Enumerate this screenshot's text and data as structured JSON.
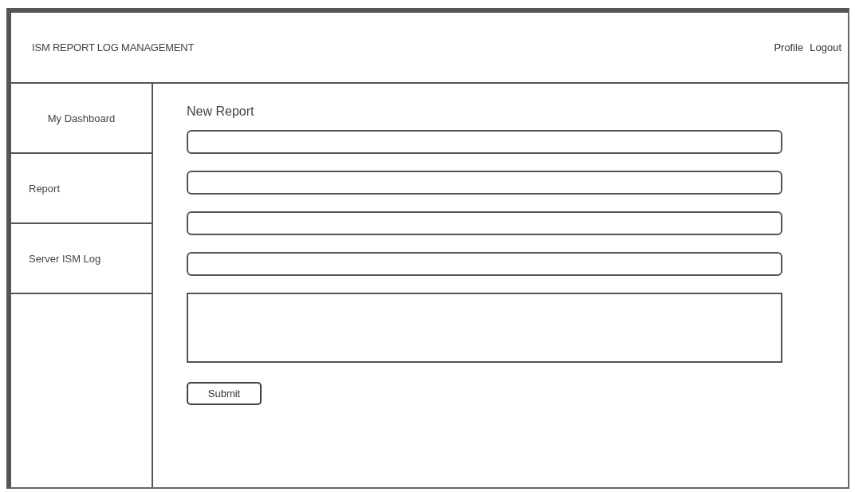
{
  "header": {
    "title": "ISM REPORT LOG MANAGEMENT",
    "links": [
      "Profile",
      "Logout"
    ]
  },
  "sidebar": {
    "items": [
      {
        "label": "My Dashboard"
      },
      {
        "label": "Report"
      },
      {
        "label": "Server ISM Log"
      }
    ]
  },
  "form": {
    "title": "New Report",
    "fields": [
      {
        "kind": "input"
      },
      {
        "kind": "input"
      },
      {
        "kind": "input"
      },
      {
        "kind": "input"
      },
      {
        "kind": "textarea"
      }
    ],
    "submit": "Submit"
  }
}
